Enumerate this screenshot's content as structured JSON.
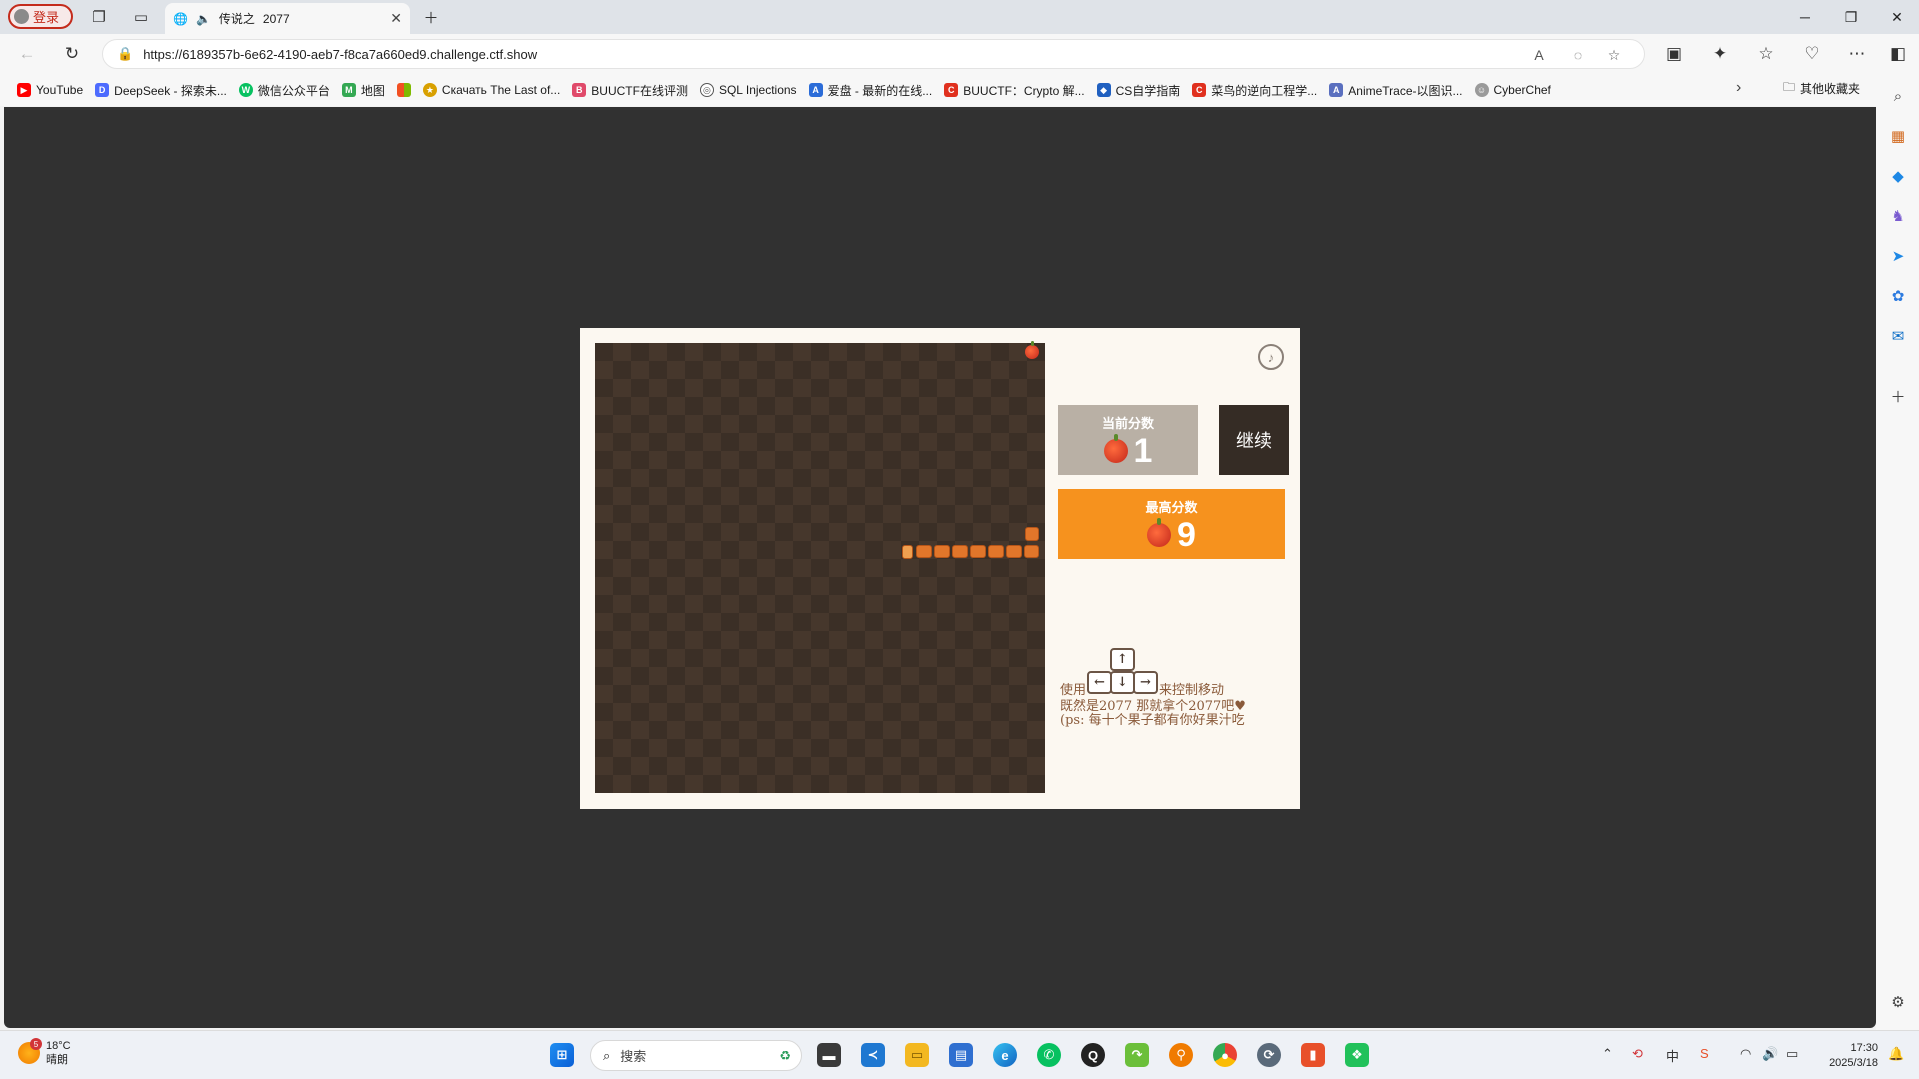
{
  "browser": {
    "profile_label": "登录",
    "tab": {
      "title": "传说之",
      "title_suffix": "2077"
    },
    "url": "https://6189357b-6e62-4190-aeb7-f8ca7a660ed9.challenge.ctf.show"
  },
  "favorites": [
    {
      "label": "YouTube",
      "icon": "youtube-icon",
      "color": "#ff0000"
    },
    {
      "label": "DeepSeek - 探索未...",
      "icon": "deepseek-icon",
      "color": "#4d6bfe"
    },
    {
      "label": "微信公众平台",
      "icon": "wechat-icon",
      "color": "#07c160"
    },
    {
      "label": "地图",
      "icon": "map-icon",
      "color": "#34a853"
    },
    {
      "label": "",
      "icon": "microsoft-icon",
      "color": "#f25022"
    },
    {
      "label": "Скачать The Last of...",
      "icon": "game-icon",
      "color": "#d8a000"
    },
    {
      "label": "BUUCTF在线评测",
      "icon": "buuctf-icon",
      "color": "#e04a6a"
    },
    {
      "label": "SQL Injections",
      "icon": "globe-icon",
      "color": "#555555"
    },
    {
      "label": "爱盘 - 最新的在线...",
      "icon": "aipan-icon",
      "color": "#2b6cd8"
    },
    {
      "label": "BUUCTF：Crypto 解...",
      "icon": "csdn-icon",
      "color": "#e0301e"
    },
    {
      "label": "CS自学指南",
      "icon": "cs-icon",
      "color": "#2060c0"
    },
    {
      "label": "菜鸟的逆向工程学...",
      "icon": "csdn-icon",
      "color": "#e0301e"
    },
    {
      "label": "AnimeTrace-以图识...",
      "icon": "anime-icon",
      "color": "#5a6fbf"
    },
    {
      "label": "CyberChef",
      "icon": "chef-icon",
      "color": "#9a9a9a"
    }
  ],
  "other_favorites_label": "其他收藏夹",
  "game": {
    "current_score_label": "当前分数",
    "current_score": "1",
    "continue_label": "继续",
    "best_score_label": "最高分数",
    "best_score": "9",
    "instruction_use": "使用",
    "instruction_control": "来控制移动",
    "instruction_line2": "既然是2077  那就拿个2077吧♥",
    "instruction_line3": "(ps: 每十个果子都有你好果汁吃",
    "keys": {
      "up": "↑",
      "left": "←",
      "down": "↓",
      "right": "→"
    },
    "colors": {
      "board": "#3b2f26",
      "best": "#f6921e",
      "current": "#b9b0a5",
      "continue": "#352c25",
      "snake": "#e2762a"
    }
  },
  "taskbar": {
    "weather_temp": "18°C",
    "weather_desc": "晴朗",
    "weather_badge": "5",
    "search_placeholder": "搜索",
    "time": "17:30",
    "date": "2025/3/18"
  }
}
